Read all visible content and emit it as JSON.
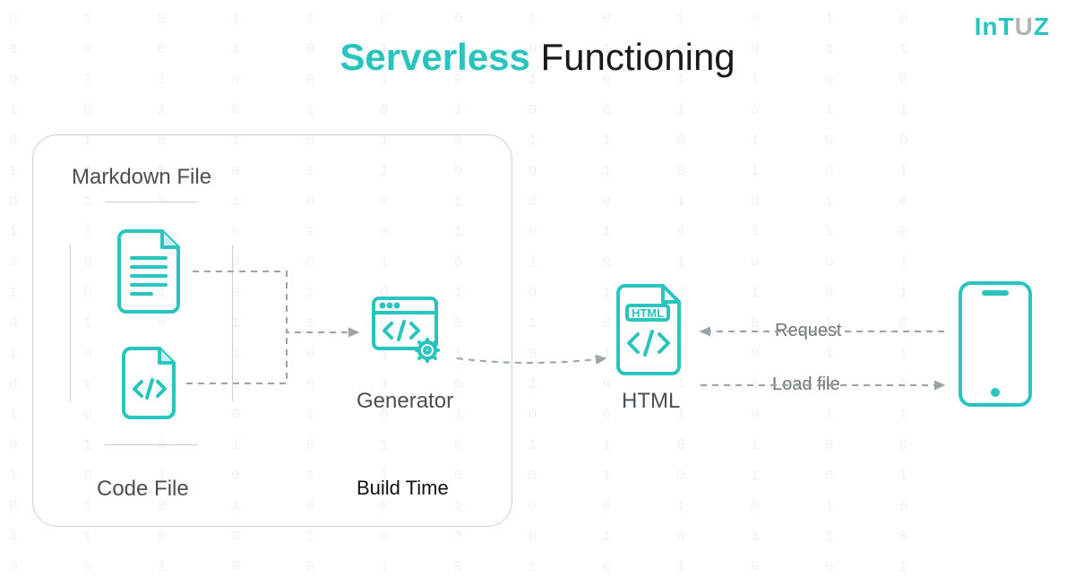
{
  "brand": {
    "name": "InTUZ",
    "left": "In",
    "mid": "T",
    "right1": "U",
    "right2": "Z"
  },
  "title": {
    "accent": "Serverless",
    "rest": " Functioning"
  },
  "labels": {
    "markdown": "Markdown File",
    "codefile": "Code File",
    "generator": "Generator",
    "buildtime": "Build Time",
    "html": "HTML",
    "request": "Request",
    "loadfile": "Load file",
    "html_badge": "HTML"
  },
  "colors": {
    "accent": "#28c4bd",
    "muted": "#9aa3a8",
    "text": "#4a4f54"
  },
  "background_binary": "0  1  0  1  1  0  0  1  0  1  0  1  0\n1  0  0  1  0  1  1  0  1  0  0  1  1\n0  1  1  0  0  1  0  1  0  1  1  0  0\n1  0  1  0  1  0  1  0  0  1  0  1  1\n0  1  0  1  0  1  0  1  1  0  1  0  0\n1  0  1  0  1  1  0  0  1  0  1  0  1\n0  1  0  1  0  0  1  0  0  1  0  1  0\n1  1  0  0  1  0  1  0  1  0  1  1  0\n0  0  1  0  0  1  0  1  0  1  0  0  1\n1  0  1  0  1  0  1  0  1  0  1  0  1\n0  1  0  1  1  0  0  1  0  1  0  1  0\n1  0  0  1  0  1  1  0  1  0  0  1  1\n0  1  1  0  0  1  0  1  0  1  1  0  0\n1  0  1  0  1  0  1  0  0  1  0  1  1\n0  1  0  1  0  1  0  1  1  0  1  0  0\n1  0  1  0  1  1  0  0  1  0  1  0  1\n0  1  0  1  0  0  1  0  0  1  0  1  0\n1  1  0  0  1  0  1  0  1  0  1  1  0\n0  0  1  0  0  1  0  1  0  1  0  0  1"
}
